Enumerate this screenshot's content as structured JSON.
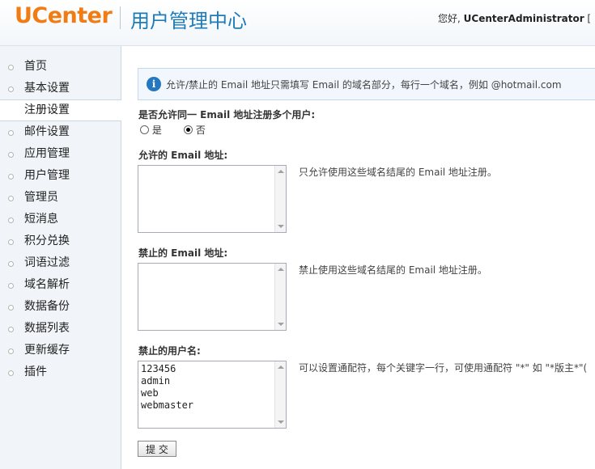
{
  "header": {
    "logo_text": "UCenter",
    "system_title": "用户管理中心",
    "greeting_prefix": "您好, ",
    "username": "UCenterAdministrator",
    "greeting_suffix": " ["
  },
  "sidebar": {
    "items": [
      {
        "label": "首页",
        "active": false
      },
      {
        "label": "基本设置",
        "active": false
      },
      {
        "label": "注册设置",
        "active": true
      },
      {
        "label": "邮件设置",
        "active": false
      },
      {
        "label": "应用管理",
        "active": false
      },
      {
        "label": "用户管理",
        "active": false
      },
      {
        "label": "管理员",
        "active": false
      },
      {
        "label": "短消息",
        "active": false
      },
      {
        "label": "积分兑换",
        "active": false
      },
      {
        "label": "词语过滤",
        "active": false
      },
      {
        "label": "域名解析",
        "active": false
      },
      {
        "label": "数据备份",
        "active": false
      },
      {
        "label": "数据列表",
        "active": false
      },
      {
        "label": "更新缓存",
        "active": false
      },
      {
        "label": "插件",
        "active": false
      }
    ]
  },
  "info": {
    "icon": "i",
    "text": "允许/禁止的 Email 地址只需填写 Email 的域名部分，每行一个域名，例如 @hotmail.com"
  },
  "form": {
    "multi_email": {
      "label": "是否允许同一 Email 地址注册多个用户:",
      "yes_label": "是",
      "no_label": "否",
      "selected": "否"
    },
    "allowed_email": {
      "label": "允许的 Email 地址:",
      "value": "",
      "hint": "只允许使用这些域名结尾的 Email 地址注册。"
    },
    "banned_email": {
      "label": "禁止的 Email 地址:",
      "value": "",
      "hint": "禁止使用这些域名结尾的 Email 地址注册。"
    },
    "banned_usernames": {
      "label": "禁止的用户名:",
      "value": "123456\nadmin\nweb\nwebmaster",
      "hint": "可以设置通配符，每个关键字一行，可使用通配符 \"*\" 如 \"*版主*\"("
    },
    "submit_label": "提 交"
  }
}
